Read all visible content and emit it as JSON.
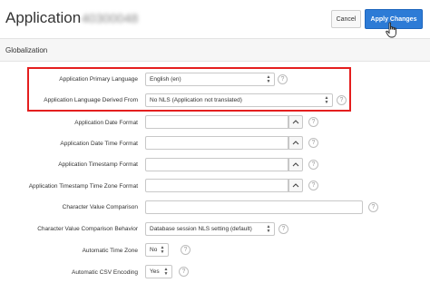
{
  "header": {
    "title": "Application",
    "app_id": "40300048",
    "cancel_label": "Cancel",
    "apply_label": "Apply Changes"
  },
  "section": {
    "title": "Globalization"
  },
  "fields": {
    "primary_language": {
      "label": "Application Primary Language",
      "value": "English (en)"
    },
    "language_derived_from": {
      "label": "Application Language Derived From",
      "value": "No NLS (Application not translated)"
    },
    "date_format": {
      "label": "Application Date Format",
      "value": ""
    },
    "date_time_format": {
      "label": "Application Date Time Format",
      "value": ""
    },
    "timestamp_format": {
      "label": "Application Timestamp Format",
      "value": ""
    },
    "timestamp_tz_format": {
      "label": "Application Timestamp Time Zone Format",
      "value": ""
    },
    "char_value_comparison": {
      "label": "Character Value Comparison",
      "value": ""
    },
    "char_value_comparison_behavior": {
      "label": "Character Value Comparison Behavior",
      "value": "Database session NLS setting (default)"
    },
    "automatic_time_zone": {
      "label": "Automatic Time Zone",
      "value": "No"
    },
    "automatic_csv_encoding": {
      "label": "Automatic CSV Encoding",
      "value": "Yes"
    }
  },
  "help_glyph": "?",
  "colors": {
    "accent": "#2d7bd6",
    "highlight": "#e41e1e"
  }
}
